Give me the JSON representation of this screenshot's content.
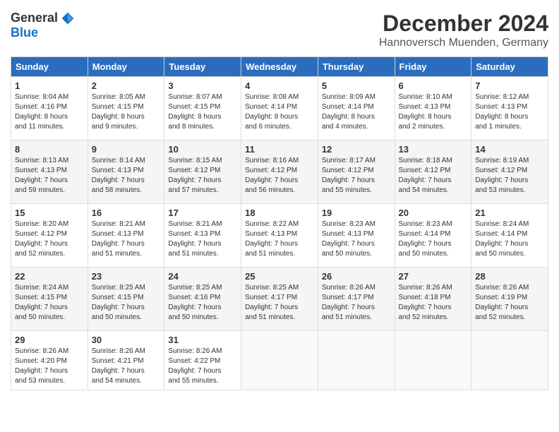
{
  "header": {
    "logo_general": "General",
    "logo_blue": "Blue",
    "month_title": "December 2024",
    "subtitle": "Hannoversch Muenden, Germany"
  },
  "days_of_week": [
    "Sunday",
    "Monday",
    "Tuesday",
    "Wednesday",
    "Thursday",
    "Friday",
    "Saturday"
  ],
  "weeks": [
    [
      {
        "day": "1",
        "sunrise": "8:04 AM",
        "sunset": "4:16 PM",
        "daylight_hours": "8",
        "daylight_minutes": "11"
      },
      {
        "day": "2",
        "sunrise": "8:05 AM",
        "sunset": "4:15 PM",
        "daylight_hours": "8",
        "daylight_minutes": "9"
      },
      {
        "day": "3",
        "sunrise": "8:07 AM",
        "sunset": "4:15 PM",
        "daylight_hours": "8",
        "daylight_minutes": "8"
      },
      {
        "day": "4",
        "sunrise": "8:08 AM",
        "sunset": "4:14 PM",
        "daylight_hours": "8",
        "daylight_minutes": "6"
      },
      {
        "day": "5",
        "sunrise": "8:09 AM",
        "sunset": "4:14 PM",
        "daylight_hours": "8",
        "daylight_minutes": "4"
      },
      {
        "day": "6",
        "sunrise": "8:10 AM",
        "sunset": "4:13 PM",
        "daylight_hours": "8",
        "daylight_minutes": "2"
      },
      {
        "day": "7",
        "sunrise": "8:12 AM",
        "sunset": "4:13 PM",
        "daylight_hours": "8",
        "daylight_minutes": "1"
      }
    ],
    [
      {
        "day": "8",
        "sunrise": "8:13 AM",
        "sunset": "4:13 PM",
        "daylight_hours": "7",
        "daylight_minutes": "59"
      },
      {
        "day": "9",
        "sunrise": "8:14 AM",
        "sunset": "4:13 PM",
        "daylight_hours": "7",
        "daylight_minutes": "58"
      },
      {
        "day": "10",
        "sunrise": "8:15 AM",
        "sunset": "4:12 PM",
        "daylight_hours": "7",
        "daylight_minutes": "57"
      },
      {
        "day": "11",
        "sunrise": "8:16 AM",
        "sunset": "4:12 PM",
        "daylight_hours": "7",
        "daylight_minutes": "56"
      },
      {
        "day": "12",
        "sunrise": "8:17 AM",
        "sunset": "4:12 PM",
        "daylight_hours": "7",
        "daylight_minutes": "55"
      },
      {
        "day": "13",
        "sunrise": "8:18 AM",
        "sunset": "4:12 PM",
        "daylight_hours": "7",
        "daylight_minutes": "54"
      },
      {
        "day": "14",
        "sunrise": "8:19 AM",
        "sunset": "4:12 PM",
        "daylight_hours": "7",
        "daylight_minutes": "53"
      }
    ],
    [
      {
        "day": "15",
        "sunrise": "8:20 AM",
        "sunset": "4:12 PM",
        "daylight_hours": "7",
        "daylight_minutes": "52"
      },
      {
        "day": "16",
        "sunrise": "8:21 AM",
        "sunset": "4:13 PM",
        "daylight_hours": "7",
        "daylight_minutes": "51"
      },
      {
        "day": "17",
        "sunrise": "8:21 AM",
        "sunset": "4:13 PM",
        "daylight_hours": "7",
        "daylight_minutes": "51"
      },
      {
        "day": "18",
        "sunrise": "8:22 AM",
        "sunset": "4:13 PM",
        "daylight_hours": "7",
        "daylight_minutes": "51"
      },
      {
        "day": "19",
        "sunrise": "8:23 AM",
        "sunset": "4:13 PM",
        "daylight_hours": "7",
        "daylight_minutes": "50"
      },
      {
        "day": "20",
        "sunrise": "8:23 AM",
        "sunset": "4:14 PM",
        "daylight_hours": "7",
        "daylight_minutes": "50"
      },
      {
        "day": "21",
        "sunrise": "8:24 AM",
        "sunset": "4:14 PM",
        "daylight_hours": "7",
        "daylight_minutes": "50"
      }
    ],
    [
      {
        "day": "22",
        "sunrise": "8:24 AM",
        "sunset": "4:15 PM",
        "daylight_hours": "7",
        "daylight_minutes": "50"
      },
      {
        "day": "23",
        "sunrise": "8:25 AM",
        "sunset": "4:15 PM",
        "daylight_hours": "7",
        "daylight_minutes": "50"
      },
      {
        "day": "24",
        "sunrise": "8:25 AM",
        "sunset": "4:16 PM",
        "daylight_hours": "7",
        "daylight_minutes": "50"
      },
      {
        "day": "25",
        "sunrise": "8:25 AM",
        "sunset": "4:17 PM",
        "daylight_hours": "7",
        "daylight_minutes": "51"
      },
      {
        "day": "26",
        "sunrise": "8:26 AM",
        "sunset": "4:17 PM",
        "daylight_hours": "7",
        "daylight_minutes": "51"
      },
      {
        "day": "27",
        "sunrise": "8:26 AM",
        "sunset": "4:18 PM",
        "daylight_hours": "7",
        "daylight_minutes": "52"
      },
      {
        "day": "28",
        "sunrise": "8:26 AM",
        "sunset": "4:19 PM",
        "daylight_hours": "7",
        "daylight_minutes": "52"
      }
    ],
    [
      {
        "day": "29",
        "sunrise": "8:26 AM",
        "sunset": "4:20 PM",
        "daylight_hours": "7",
        "daylight_minutes": "53"
      },
      {
        "day": "30",
        "sunrise": "8:26 AM",
        "sunset": "4:21 PM",
        "daylight_hours": "7",
        "daylight_minutes": "54"
      },
      {
        "day": "31",
        "sunrise": "8:26 AM",
        "sunset": "4:22 PM",
        "daylight_hours": "7",
        "daylight_minutes": "55"
      },
      null,
      null,
      null,
      null
    ]
  ]
}
